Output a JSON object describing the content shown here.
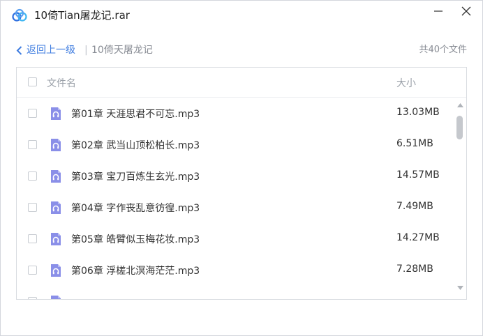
{
  "window": {
    "title": "10倚Tian屠龙记.rar"
  },
  "nav": {
    "back_label": "返回上一级",
    "separator": "|",
    "current_folder": "10倚天屠龙记",
    "file_count": "共40个文件"
  },
  "list": {
    "header": {
      "name": "文件名",
      "size": "大小"
    },
    "rows": [
      {
        "name": "第01章 天涯思君不可忘.mp3",
        "size": "13.03MB"
      },
      {
        "name": "第02章 武当山顶松柏长.mp3",
        "size": "6.51MB"
      },
      {
        "name": "第03章 宝刀百炼生玄光.mp3",
        "size": "14.57MB"
      },
      {
        "name": "第04章 字作丧乱意彷徨.mp3",
        "size": "7.49MB"
      },
      {
        "name": "第05章 皓臂似玉梅花妆.mp3",
        "size": "14.27MB"
      },
      {
        "name": "第06章 浮槎北溟海茫茫.mp3",
        "size": "7.28MB"
      }
    ]
  },
  "colors": {
    "accent": "#3f7de0",
    "audio_icon": "#8a8fe8"
  }
}
